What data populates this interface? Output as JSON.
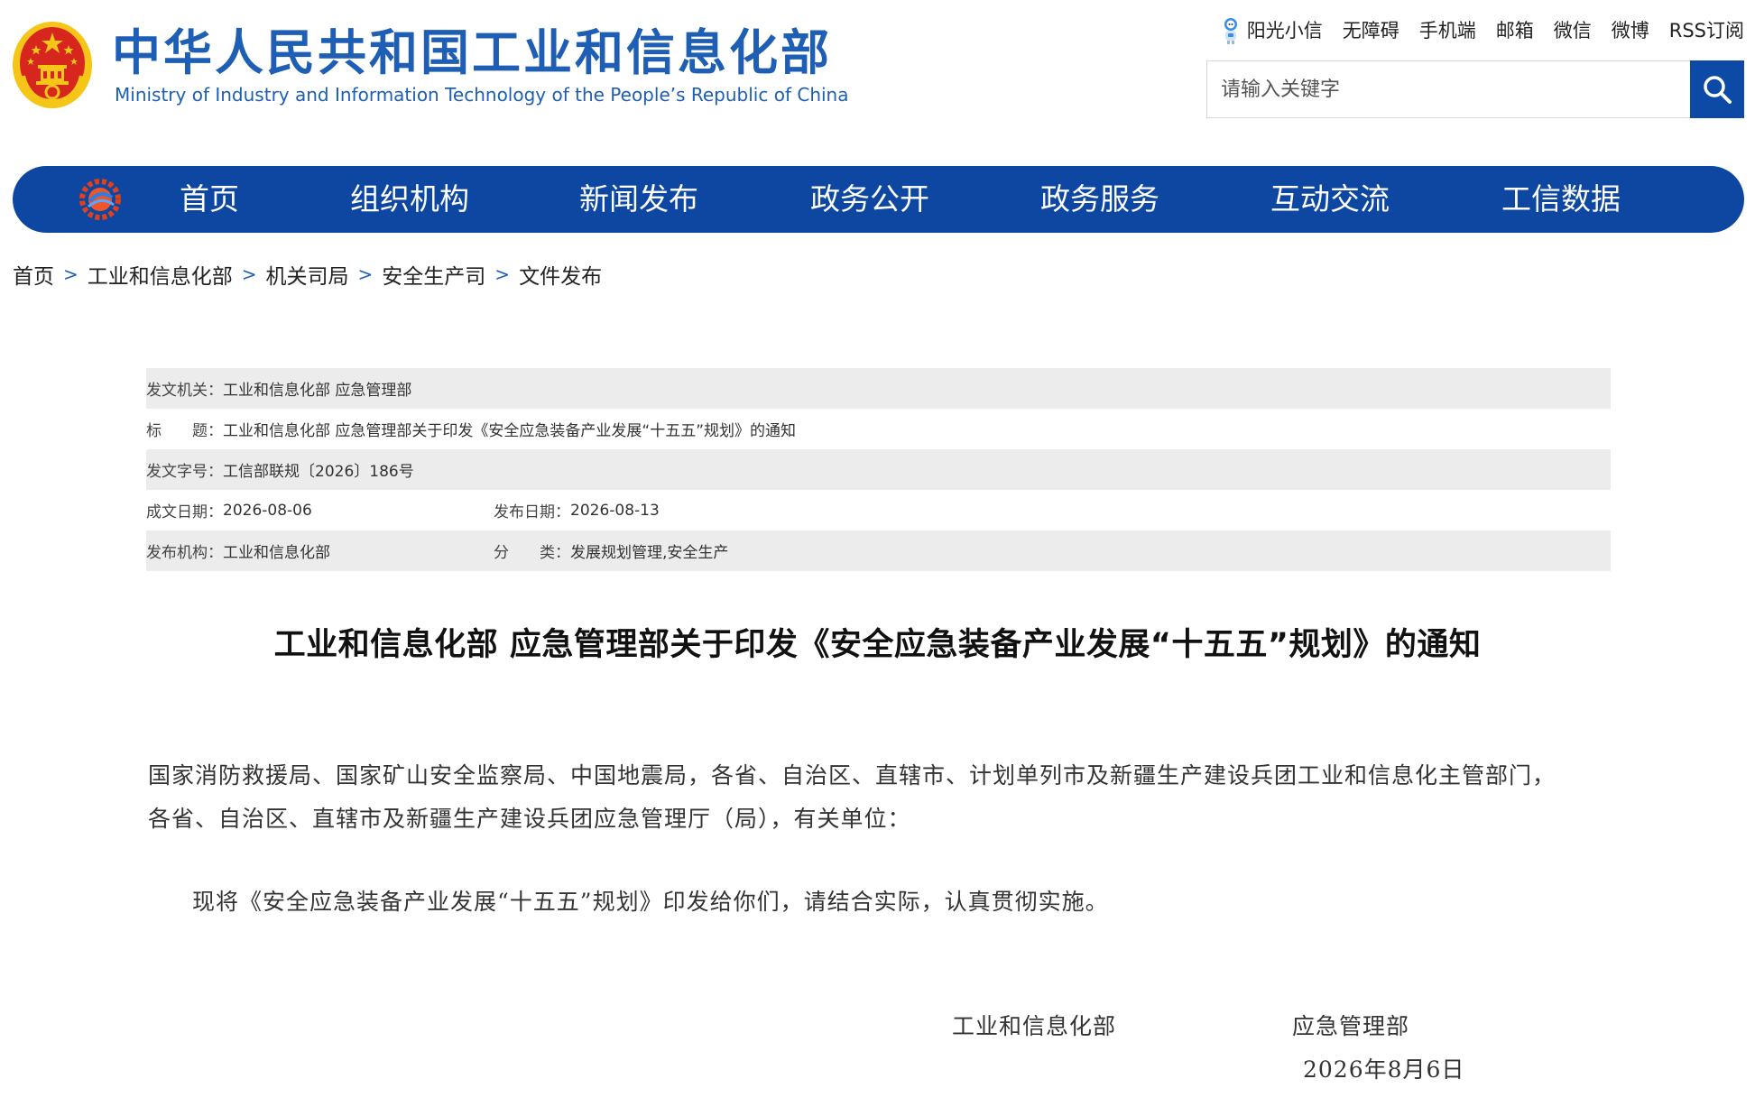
{
  "header": {
    "site_title": "中华人民共和国工业和信息化部",
    "site_subtitle": "Ministry of Industry and Information Technology of the People’s Republic of China",
    "top_links": [
      "阳光小信",
      "无障碍",
      "手机端",
      "邮箱",
      "微信",
      "微博",
      "RSS订阅"
    ],
    "search_placeholder": "请输入关键字",
    "colors": {
      "brand_blue": "#1e5fb5",
      "nav_blue": "#0d47a1",
      "emblem_red": "#d7261e",
      "emblem_gold": "#f5c518"
    }
  },
  "nav": {
    "items": [
      "首页",
      "组织机构",
      "新闻发布",
      "政务公开",
      "政务服务",
      "互动交流",
      "工信数据"
    ]
  },
  "breadcrumb": [
    "首页",
    "工业和信息化部",
    "机关司局",
    "安全生产司",
    "文件发布"
  ],
  "meta": {
    "issuer_label": "发文机关：",
    "issuer": "工业和信息化部 应急管理部",
    "title_label": "标　　题：",
    "title": "工业和信息化部 应急管理部关于印发《安全应急装备产业发展“十五五”规划》的通知",
    "doc_no_label": "发文字号：",
    "doc_no": "工信部联规〔2026〕186号",
    "created_label": "成文日期：",
    "created": "2026-08-06",
    "published_label": "发布日期：",
    "published": "2026-08-13",
    "org_label": "发布机构：",
    "org": "工业和信息化部",
    "category_label": "分　　类：",
    "category": "发展规划管理,安全生产"
  },
  "document": {
    "title": "工业和信息化部 应急管理部关于印发《安全应急装备产业发展“十五五”规划》的通知",
    "recipients_line1": "国家消防救援局、国家矿山安全监察局、中国地震局，各省、自治区、直辖市、计划单列市及新疆生产建设兵团工业和信息化主管部门，",
    "recipients_line2": "各省、自治区、直辖市及新疆生产建设兵团应急管理厅（局），有关单位：",
    "body": "现将《安全应急装备产业发展“十五五”规划》印发给你们，请结合实际，认真贯彻实施。",
    "signatory1": "工业和信息化部",
    "signatory2": "应急管理部",
    "date": "2026年8月6日"
  }
}
